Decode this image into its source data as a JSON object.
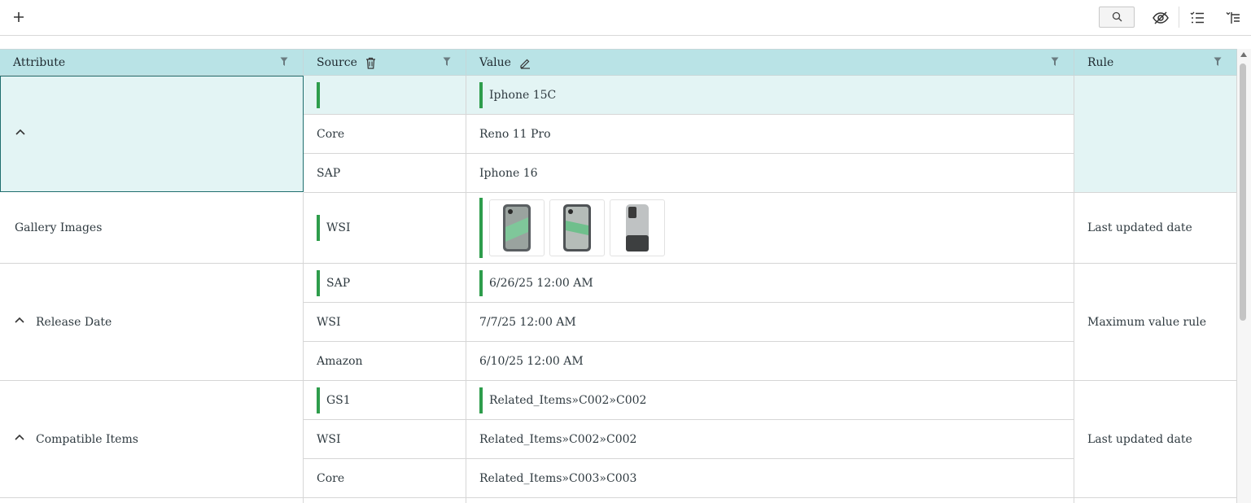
{
  "toolbar": {
    "add_icon": "plus-icon",
    "search_icon": "search-icon",
    "hide_icon": "eye-off-icon",
    "list_icon": "list-icon",
    "tree_icon": "tree-list-icon"
  },
  "columns": {
    "attribute": "Attribute",
    "source": "Source",
    "value": "Value",
    "rule": "Rule"
  },
  "rows": {
    "r1": {
      "attribute": "",
      "rule": "",
      "sources": [
        "",
        "Core",
        "SAP"
      ],
      "values": [
        "Iphone 15C",
        "Reno 11 Pro",
        "Iphone 16"
      ]
    },
    "r2": {
      "attribute": "Gallery Images",
      "rule": "Last updated date",
      "source": "WSI",
      "images": [
        "phone-image-1",
        "phone-image-2",
        "phone-image-3"
      ]
    },
    "r3": {
      "attribute": "Release Date",
      "rule": "Maximum value rule",
      "sources": [
        "SAP",
        "WSI",
        "Amazon"
      ],
      "values": [
        "6/26/25 12:00 AM",
        "7/7/25 12:00 AM",
        "6/10/25 12:00 AM"
      ]
    },
    "r4": {
      "attribute": "Compatible Items",
      "rule": "Last updated date",
      "sources": [
        "GS1",
        "WSI",
        "Core"
      ],
      "values": [
        "Related_Items»C002»C002",
        "Related_Items»C002»C002",
        "Related_Items»C003»C003"
      ]
    }
  },
  "colors": {
    "header_bg": "#b9e3e6",
    "selected_bg": "#e3f4f4",
    "winner_bar": "#2e9d4c",
    "focus_border": "#1f6e6e"
  }
}
